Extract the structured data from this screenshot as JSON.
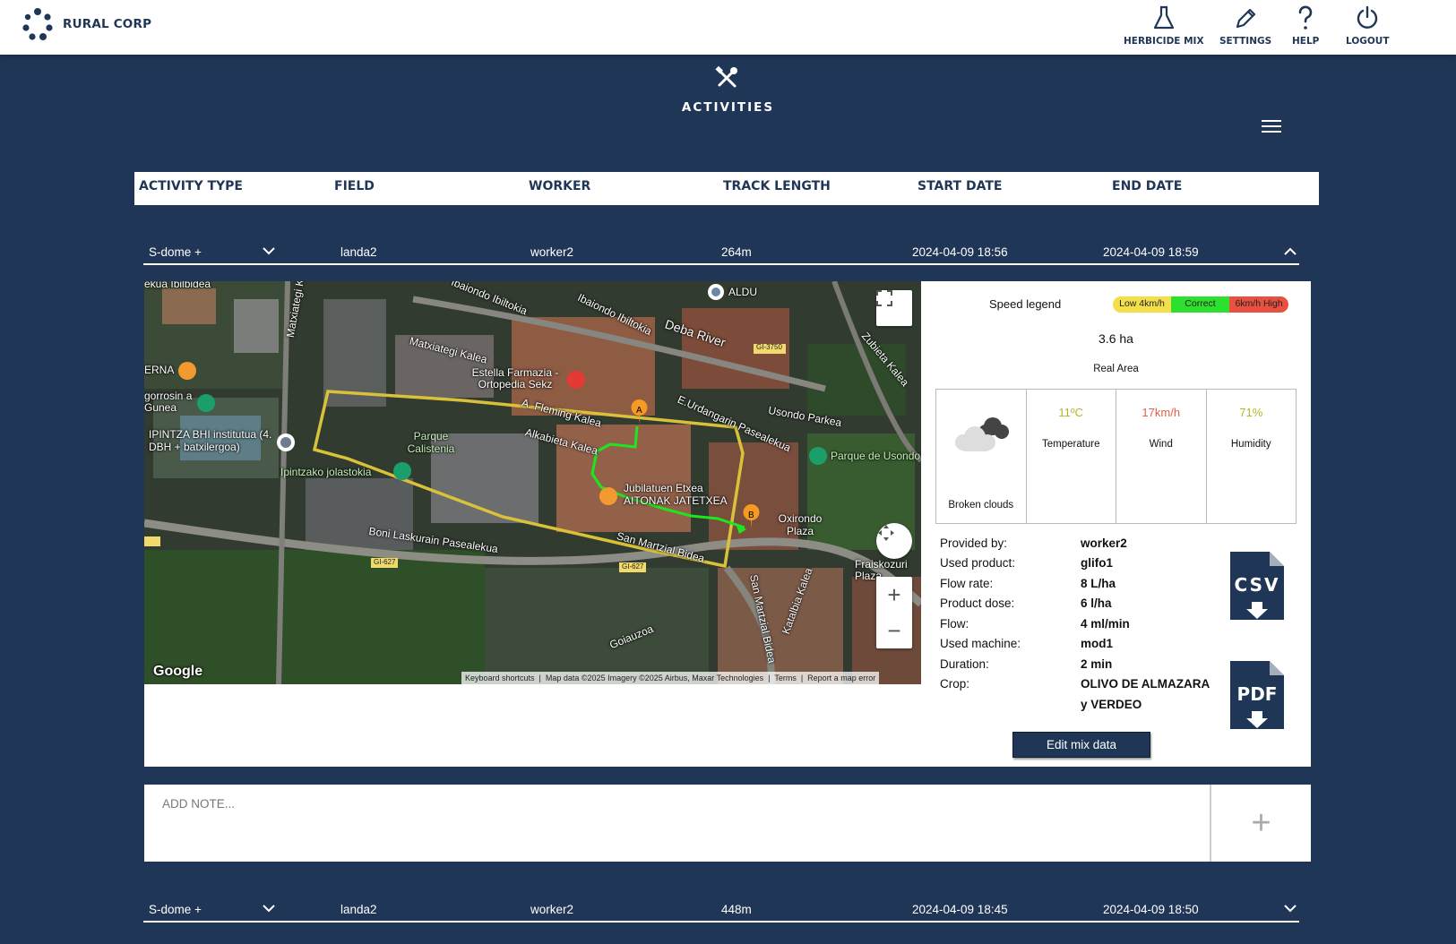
{
  "header": {
    "brand": "RURAL CORP",
    "nav": [
      {
        "label": "HERBICIDE MIX",
        "icon": "flask-icon"
      },
      {
        "label": "SETTINGS",
        "icon": "pencil-icon"
      },
      {
        "label": "HELP",
        "icon": "question-icon"
      },
      {
        "label": "LOGOUT",
        "icon": "power-icon"
      }
    ]
  },
  "page": {
    "title": "ACTIVITIES",
    "icon": "tools-icon"
  },
  "table": {
    "columns": [
      "ACTIVITY TYPE",
      "FIELD",
      "WORKER",
      "TRACK LENGTH",
      "START DATE",
      "END DATE"
    ],
    "rows": [
      {
        "type": "S-dome +",
        "field": "landa2",
        "worker": "worker2",
        "length": "264m",
        "start": "2024-04-09 18:56",
        "end": "2024-04-09 18:59",
        "expanded": true
      },
      {
        "type": "S-dome +",
        "field": "landa2",
        "worker": "worker2",
        "length": "448m",
        "start": "2024-04-09 18:45",
        "end": "2024-04-09 18:50",
        "expanded": false
      }
    ]
  },
  "map": {
    "labels": [
      "ALDU",
      "Ibaiondo Ibiltokia",
      "Ibaiondo Ibiltokia",
      "Deba River",
      "GI-3750",
      "Zubieta Kalea",
      "Matxiategi Kalea",
      "Estella Farmazia - Ortopedia Sekz",
      "Matxiategi Kalea",
      "ERNA",
      "gorrosin a Gunea",
      "IPINTZA BHI institutua (4. DBH + batxilergoa)",
      "Parque Calistenia",
      "A. Fleming Kalea",
      "E.Urdangarin Pasealekua",
      "Usondo Parkea",
      "Alkabieta Kalea",
      "Parque de Usondo",
      "Ipintzako jolastokia",
      "Jubilatuen Etxea AITONAK JATETXEA",
      "Oxirondo Plaza",
      "Boni Laskurain Pasealekua",
      "GI-627",
      "San Martzial Bidea",
      "GI-627",
      "Fraiskozuri Plaza",
      "San Martzial Bidea",
      "Katalbia Kalea",
      "Goiauzoa",
      "ekua Ibilbidea"
    ],
    "markers": [
      "A",
      "B"
    ],
    "google": "Google",
    "attribution": [
      "Keyboard shortcuts",
      "Map data ©2025 Imagery ©2025 Airbus, Maxar Technologies",
      "Terms",
      "Report a map error"
    ],
    "colors": {
      "boundary": "#d9c13a",
      "track": "#1ee61e",
      "marker": "#f59a23"
    }
  },
  "speed_legend": {
    "title": "Speed legend",
    "segments": [
      {
        "label": "Low 4km/h",
        "color": "#f2df4a"
      },
      {
        "label": "Correct",
        "color": "#2de02d"
      },
      {
        "label": "6km/h High",
        "color": "#e9503f"
      }
    ]
  },
  "area": {
    "value": "3.6 ha",
    "label": "Real Area"
  },
  "weather": {
    "condition": "Broken clouds",
    "icon": "broken-clouds-icon",
    "temperature": {
      "value": "11ºC",
      "label": "Temperature",
      "color": "#b5b52a"
    },
    "wind": {
      "value": "17km/h",
      "label": "Wind",
      "color": "#e2604a"
    },
    "humidity": {
      "value": "71%",
      "label": "Humidity",
      "color": "#b5b52a"
    }
  },
  "details": [
    {
      "key": "Provided by:",
      "value": "worker2"
    },
    {
      "key": "Used product:",
      "value": "glifo1"
    },
    {
      "key": "Flow rate:",
      "value": "8 L/ha"
    },
    {
      "key": "Product dose:",
      "value": "6 l/ha"
    },
    {
      "key": "Flow:",
      "value": "4 ml/min"
    },
    {
      "key": "Used machine:",
      "value": "mod1"
    },
    {
      "key": "Duration:",
      "value": "2 min"
    },
    {
      "key": "Crop:",
      "value": "OLIVO DE ALMAZARA y VERDEO"
    }
  ],
  "downloads": {
    "csv": "CSV",
    "pdf": "PDF"
  },
  "edit_button": "Edit mix data",
  "note": {
    "placeholder": "ADD NOTE...",
    "add": "+"
  }
}
